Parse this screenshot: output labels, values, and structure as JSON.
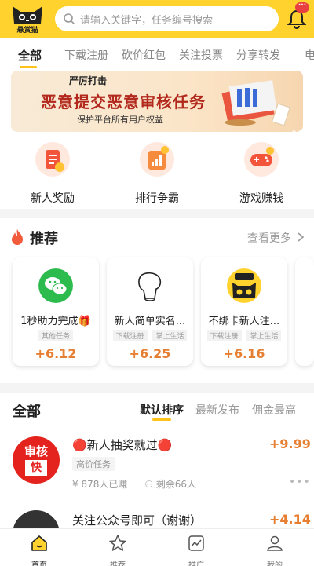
{
  "header": {
    "logo_text": "悬赏猫",
    "search_placeholder": "请输入关键字，任务编号搜索",
    "notification_badge": "···"
  },
  "tabs": [
    "全部",
    "下载注册",
    "砍价红包",
    "关注投票",
    "分享转发",
    "电"
  ],
  "banner": {
    "subtitle_top": "严厉打击",
    "title": "恶意提交恶意审核任务",
    "subtitle_bottom": "保护平台所有用户权益"
  },
  "quick_links": [
    {
      "label": "新人奖励",
      "icon": "gift-list-icon"
    },
    {
      "label": "排行争霸",
      "icon": "chart-up-icon"
    },
    {
      "label": "游戏赚钱",
      "icon": "gamepad-icon"
    }
  ],
  "recommend": {
    "title": "推荐",
    "more": "查看更多",
    "cards": [
      {
        "name": "1秒助力完成🎁",
        "tags": [
          "其他任务"
        ],
        "reward": "+6.12",
        "icon": "wechat-icon"
      },
      {
        "name": "新人简单实名...",
        "tags": [
          "下载注册",
          "掌上生活"
        ],
        "reward": "+6.25",
        "icon": "cat-outline-icon"
      },
      {
        "name": "不绑卡新人注...",
        "tags": [
          "下载注册",
          "掌上生活"
        ],
        "reward": "+6.16",
        "icon": "xuanshangmao-logo-icon"
      }
    ]
  },
  "all": {
    "title": "全部",
    "sorts": [
      "默认排序",
      "最新发布",
      "佣金最高"
    ],
    "tasks": [
      {
        "title": "🔴新人抽奖就过🔴",
        "price": "+9.99",
        "tag": "高价任务",
        "earned": "878人已赚",
        "remaining": "剩余66人",
        "avatar_text_1": "审核",
        "avatar_text_2": "快"
      },
      {
        "title": "关注公众号即可（谢谢）",
        "price": "+4.14"
      }
    ]
  },
  "nav": [
    {
      "label": "首页",
      "icon": "home-icon"
    },
    {
      "label": "推荐",
      "icon": "star-icon"
    },
    {
      "label": "推广",
      "icon": "chart-icon"
    },
    {
      "label": "我的",
      "icon": "user-icon"
    }
  ],
  "colors": {
    "brand_yellow": "#ffd22e",
    "accent_orange": "#e77f32",
    "banner_red": "#b2281c"
  }
}
